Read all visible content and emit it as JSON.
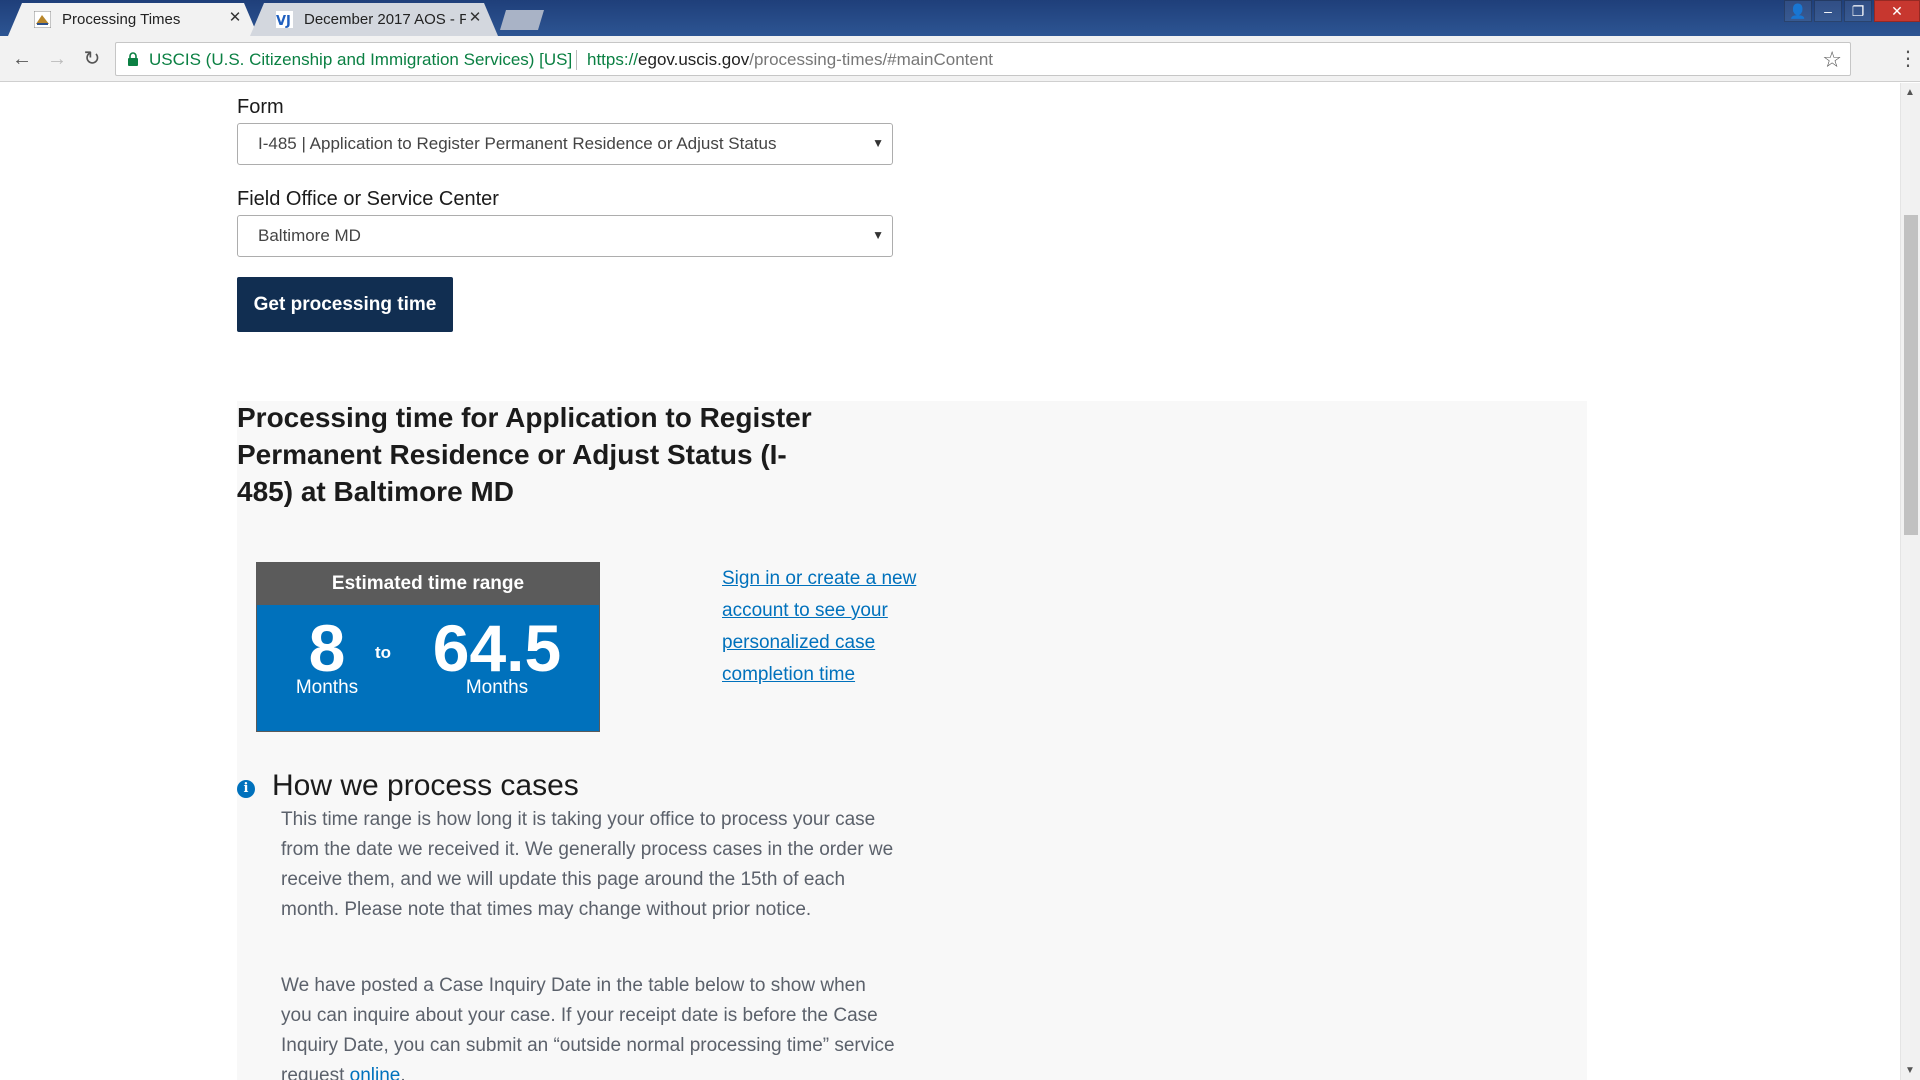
{
  "browser": {
    "tabs": [
      {
        "title": "Processing Times",
        "active": true
      },
      {
        "title": "December 2017 AOS - P",
        "active": false
      }
    ],
    "site_identity": "USCIS (U.S. Citizenship and Immigration Services) [US]",
    "url": {
      "scheme": "https://",
      "host": "egov.uscis.gov",
      "path": "/processing-times/#mainContent"
    }
  },
  "form": {
    "form_label": "Form",
    "form_value": "I-485 | Application to Register Permanent Residence or Adjust Status",
    "office_label": "Field Office or Service Center",
    "office_value": "Baltimore MD",
    "submit_label": "Get processing time"
  },
  "result": {
    "title": "Processing time for Application to Register Permanent Residence or Adjust Status (I-485) at Baltimore MD",
    "range_heading": "Estimated time range",
    "low_value": "8",
    "low_unit": "Months",
    "separator": "to",
    "high_value": "64.5",
    "high_unit": "Months",
    "signin_link": "Sign in or create a new account to see your personalized case completion time"
  },
  "info": {
    "heading": "How we process cases",
    "paragraph_1": "This time range is how long it is taking your office to process your case from the date we received it. We generally process cases in the order we receive them, and we will update this page around the 15th of each month. Please note that times may change without prior notice.",
    "paragraph_2_text": "We have posted a Case Inquiry Date in the table below to show when you can inquire about your case. If your receipt date is before the Case Inquiry Date, you can submit an “outside normal processing time” service request ",
    "paragraph_2_link": "online",
    "paragraph_2_end": "."
  },
  "icons": {
    "favicon_tab1": "uscis-favicon",
    "favicon_tab2": "vj-favicon",
    "lock": "lock-icon",
    "bookmark": "star-icon",
    "info": "info-icon"
  },
  "colors": {
    "primary_button": "#112e51",
    "range_blue": "#0071bc",
    "range_header": "#5b5b5b",
    "link": "#0071bc"
  }
}
